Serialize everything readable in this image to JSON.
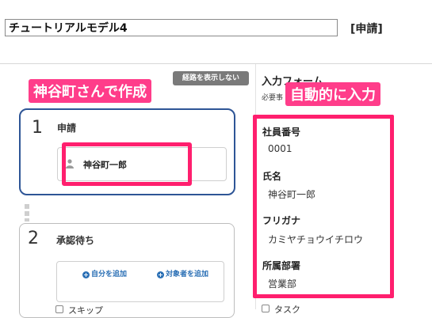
{
  "header": {
    "title_value": "チュートリアルモデル4",
    "status_label": "[申請]"
  },
  "route": {
    "hide_route_label": "経路を表示しない",
    "steps": [
      {
        "number": "1",
        "label": "申請",
        "approver": "神谷町一郎"
      },
      {
        "number": "2",
        "label": "承認待ち",
        "add_self": "自分を追加",
        "add_target": "対象者を追加",
        "skip_label": "スキップ"
      }
    ]
  },
  "callouts": {
    "left": "神谷町さんで作成",
    "right": "自動的に入力"
  },
  "form": {
    "title": "入力フォーム",
    "required_note": "必要事",
    "fields": [
      {
        "label": "社員番号",
        "value": "0001"
      },
      {
        "label": "氏名",
        "value": "神谷町一郎"
      },
      {
        "label": "フリガナ",
        "value": "カミヤチョウイチロウ"
      },
      {
        "label": "所属部署",
        "value": "営業部"
      }
    ],
    "task_label": "タスク"
  },
  "colors": {
    "highlight": "#ff1f6e",
    "step_active_border": "#2e5596",
    "link": "#2a6fb5"
  },
  "icons": [
    "person-icon",
    "plus-circle-icon"
  ]
}
